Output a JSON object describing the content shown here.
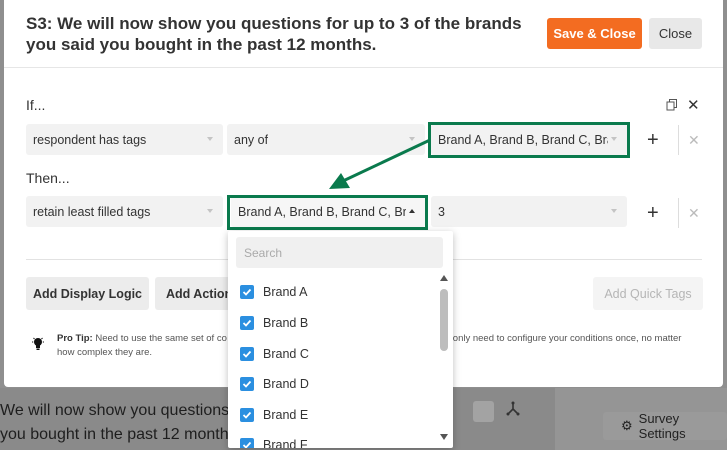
{
  "background": {
    "top_fragment": "S",
    "text_line1": "We will now show you questions",
    "text_line2": "you bought in the past 12 month",
    "survey_settings": "Survey Settings"
  },
  "modal": {
    "title": "S3: We will now show you questions for up to 3 of the brands you said you bought in the past 12 months.",
    "save_close": "Save & Close",
    "close": "Close",
    "if_label": "If...",
    "then_label": "Then...",
    "if_row": {
      "field": "respondent has tags",
      "operator": "any of",
      "value": "Brand A, Brand B, Brand C, Bra"
    },
    "then_row": {
      "action": "retain least filled tags",
      "value": "Brand A, Brand B, Brand C, Bra",
      "count": "3"
    },
    "add_display_logic": "Add Display Logic",
    "add_action": "Add Action",
    "add_quick_tags": "Add Quick Tags",
    "pro_tip_label": "Pro Tip:",
    "pro_tip_text1": "Need to use the same set of co",
    "pro_tip_text2": "u only need to configure your conditions once, no matter",
    "pro_tip_text3": "how complex they are."
  },
  "dropdown": {
    "search_placeholder": "Search",
    "options": [
      "Brand A",
      "Brand B",
      "Brand C",
      "Brand D",
      "Brand E",
      "Brand F"
    ]
  },
  "colors": {
    "accent": "#f36c21",
    "highlight": "#0a7a4d",
    "checkbox": "#2b8fe0"
  }
}
